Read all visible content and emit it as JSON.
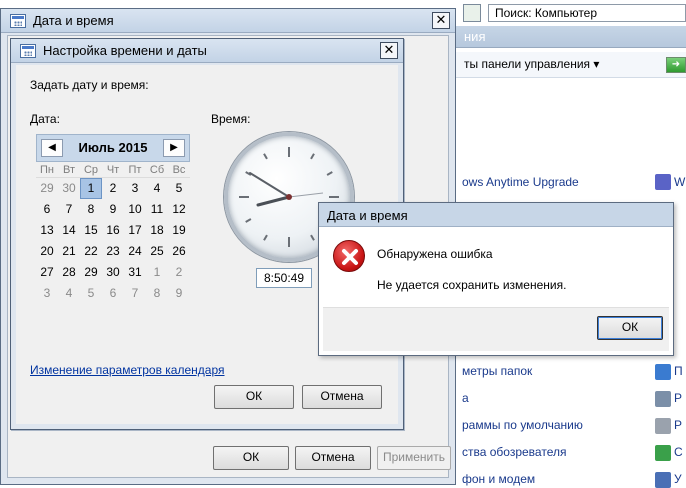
{
  "background": {
    "search_text": "Поиск: Компьютер",
    "header_fragment": "ния",
    "toolbar_label": "ты панели управления ▾",
    "items": [
      "ows Anytime Upgrade",
      "метры папок",
      "а",
      "раммы по умолчанию",
      "ства обозревателя",
      "фон и модем"
    ],
    "right_items": [
      "W",
      "П",
      "Р",
      "Р",
      "С",
      "У"
    ]
  },
  "outer_window": {
    "title": "Дата и время",
    "close_glyph": "✕",
    "ok_label": "ОК",
    "cancel_label": "Отмена",
    "apply_label": "Применить"
  },
  "inner_window": {
    "title": "Настройка времени и даты",
    "close_glyph": "✕",
    "prompt": "Задать дату и время:",
    "date_label": "Дата:",
    "time_label": "Время:",
    "calendar": {
      "month_year": "Июль 2015",
      "prev": "◀",
      "next": "▶",
      "weekdays": [
        "Пн",
        "Вт",
        "Ср",
        "Чт",
        "Пт",
        "Сб",
        "Вс"
      ],
      "days": [
        "29",
        "30",
        "1",
        "2",
        "3",
        "4",
        "5",
        "6",
        "7",
        "8",
        "9",
        "10",
        "11",
        "12",
        "13",
        "14",
        "15",
        "16",
        "17",
        "18",
        "19",
        "20",
        "21",
        "22",
        "23",
        "24",
        "25",
        "26",
        "27",
        "28",
        "29",
        "30",
        "31",
        "1",
        "2",
        "3",
        "4",
        "5",
        "6",
        "7",
        "8",
        "9"
      ]
    },
    "time_value": "8:50:49",
    "calendar_link": "Изменение параметров календаря",
    "ok_label": "ОК",
    "cancel_label": "Отмена"
  },
  "error_dialog": {
    "title": "Дата и время",
    "heading": "Обнаружена ошибка",
    "message": "Не удается сохранить изменения.",
    "ok_label": "ОК"
  },
  "colors": {
    "title_blue": "#c7d6e7",
    "error_red": "#c81414",
    "link_blue": "#0033a0"
  }
}
